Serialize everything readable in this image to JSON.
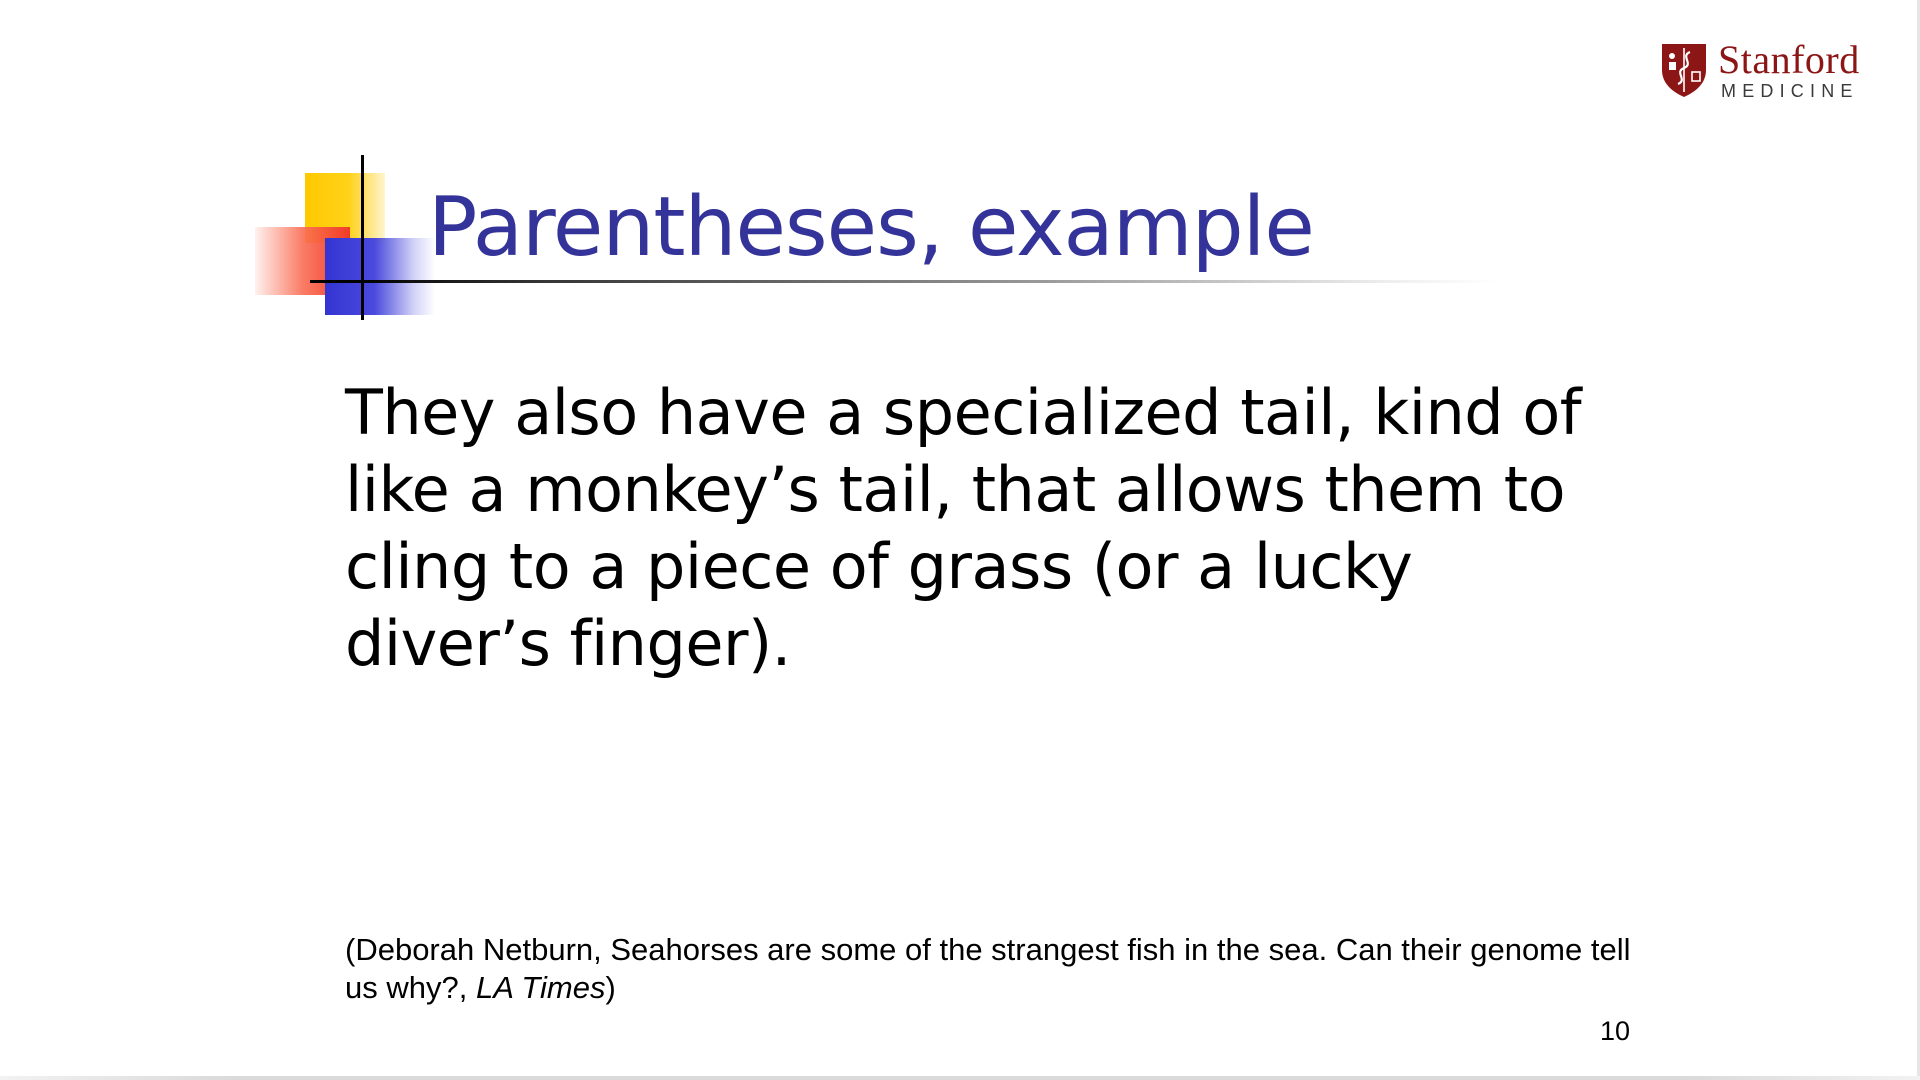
{
  "logo": {
    "wordmark": "Stanford",
    "subtitle": "MEDICINE",
    "color": "#8c1515"
  },
  "slide": {
    "title": "Parentheses, example",
    "title_color": "#333399",
    "body": "They also have a specialized tail, kind of like a monkey’s tail, that allows them to cling to a piece of grass (or a lucky diver’s finger).",
    "citation": {
      "prefix": "(Deborah Netburn, Seahorses are some of the strangest fish in the sea. Can their genome tell us why?, ",
      "source": "LA Times",
      "suffix": ")"
    },
    "page_number": "10"
  },
  "decoration_colors": {
    "yellow": "#ffc900",
    "red": "#f03b28",
    "blue": "#3434d2"
  }
}
